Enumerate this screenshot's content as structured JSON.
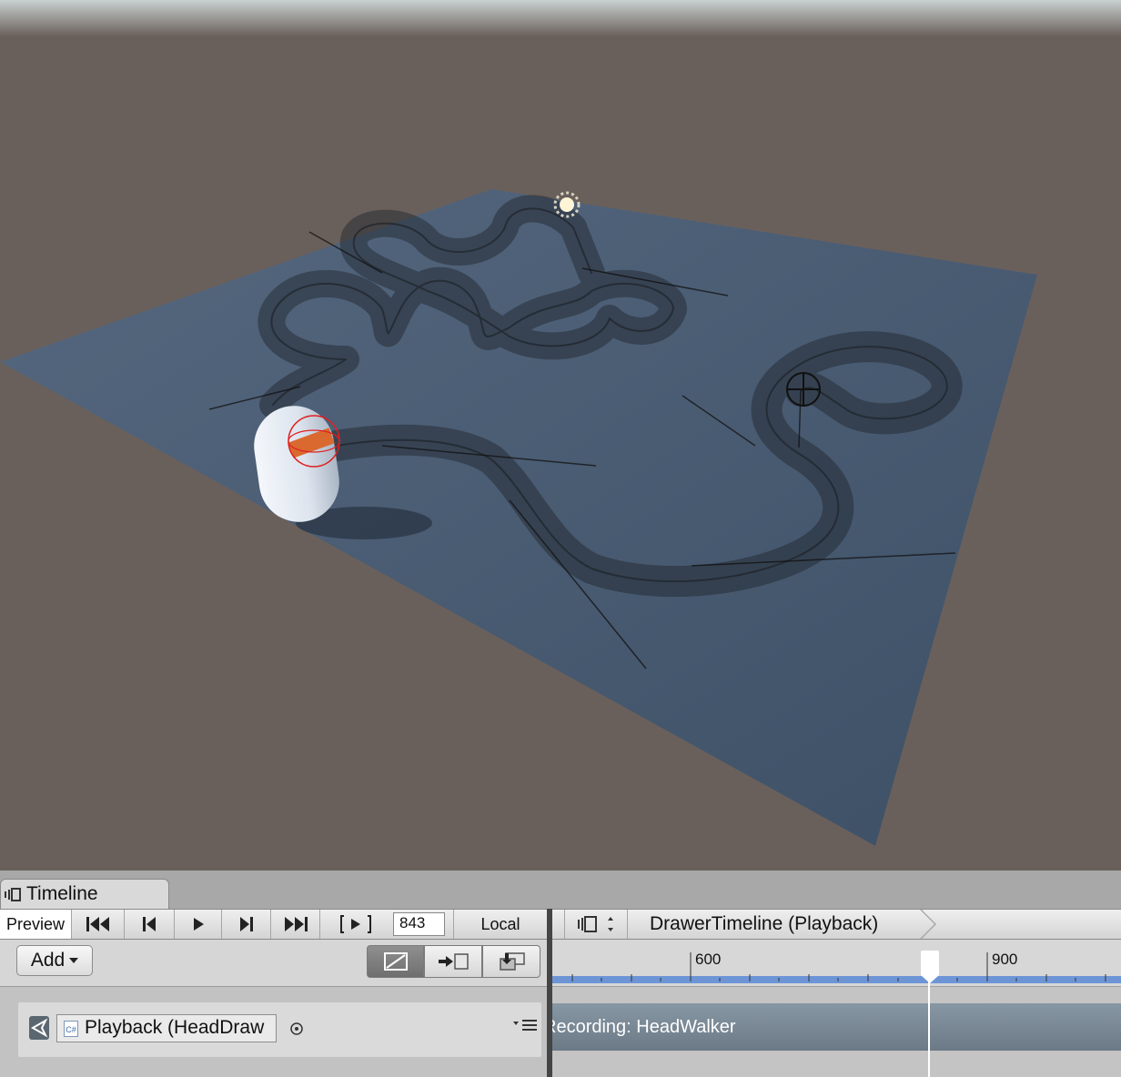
{
  "scene": {
    "colors": {
      "ground": "#6a605b",
      "plane": "#4a5d75",
      "sky": "#c7cfcf",
      "capsule": "#dfe6ef",
      "box": "#d9692f"
    },
    "icons": [
      "light-gizmo",
      "camera-gizmo",
      "capsule-object",
      "head-box-object",
      "path-mesh"
    ]
  },
  "timeline": {
    "tab_label": "Timeline",
    "toolbar": {
      "preview_label": "Preview",
      "frame_value": "843",
      "space_label": "Local",
      "asset_name": "DrawerTimeline (Playback)"
    },
    "add_label": "Add",
    "ruler_labels": [
      "600",
      "900"
    ],
    "track": {
      "binding_label": "Playback (HeadDraw",
      "clip_label": "Recording: HeadWalker",
      "csharp_label": "C#"
    }
  }
}
